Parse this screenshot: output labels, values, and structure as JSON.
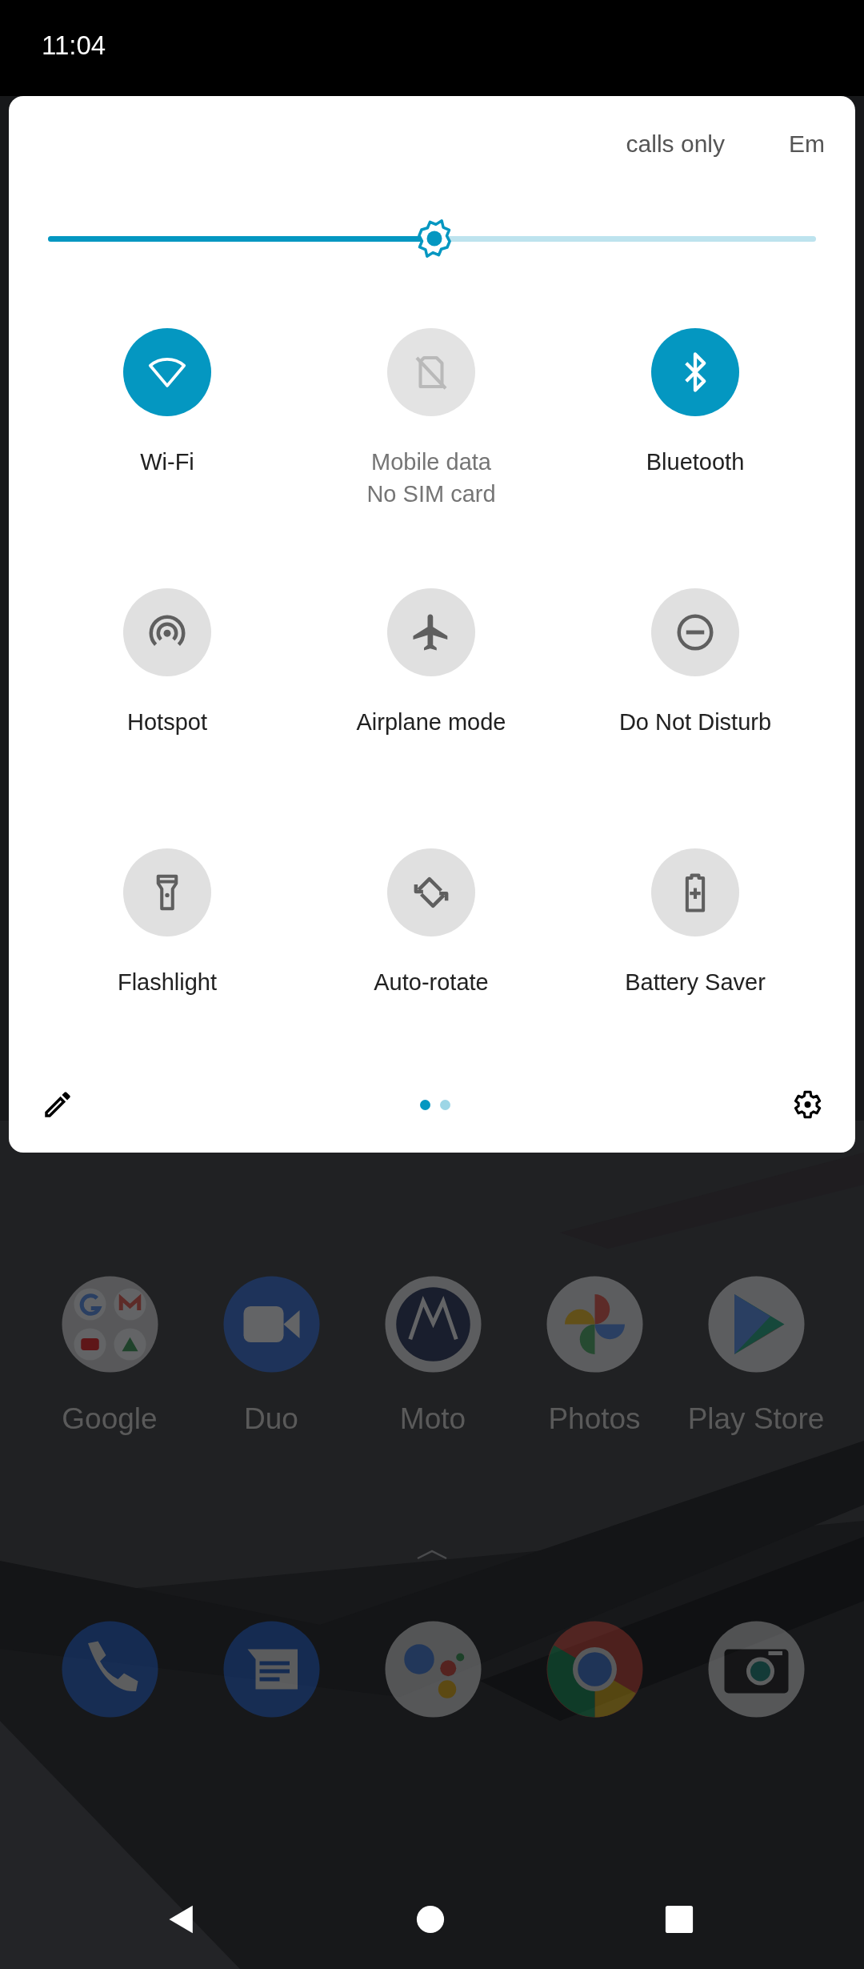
{
  "status_bar": {
    "time": "11:04"
  },
  "quick_settings": {
    "header_texts": [
      "calls only",
      "Em"
    ],
    "brightness": {
      "level": 0.503
    },
    "tiles": [
      {
        "kind": "wifi",
        "label": "Wi-Fi",
        "on": true,
        "disabled": false
      },
      {
        "kind": "mobile-data",
        "label": "Mobile data",
        "sublabel": "No SIM card",
        "on": false,
        "disabled": true
      },
      {
        "kind": "bluetooth",
        "label": "Bluetooth",
        "on": true,
        "disabled": false
      },
      {
        "kind": "hotspot",
        "label": "Hotspot",
        "on": false,
        "disabled": false
      },
      {
        "kind": "airplane",
        "label": "Airplane mode",
        "on": false,
        "disabled": false
      },
      {
        "kind": "dnd",
        "label": "Do Not Disturb",
        "on": false,
        "disabled": false
      },
      {
        "kind": "flashlight",
        "label": "Flashlight",
        "on": false,
        "disabled": false
      },
      {
        "kind": "rotate",
        "label": "Auto-rotate",
        "on": false,
        "disabled": false
      },
      {
        "kind": "battery",
        "label": "Battery Saver",
        "on": false,
        "disabled": false
      }
    ],
    "page_dots": [
      {
        "selected": true
      },
      {
        "selected": false
      }
    ]
  },
  "home_screen": {
    "apps": [
      {
        "kind": "folder",
        "label": "Google"
      },
      {
        "kind": "video",
        "label": "Duo"
      },
      {
        "kind": "moto",
        "label": "Moto"
      },
      {
        "kind": "photos",
        "label": "Photos"
      },
      {
        "kind": "play",
        "label": "Play Store"
      }
    ],
    "dock": [
      {
        "kind": "phone"
      },
      {
        "kind": "messages"
      },
      {
        "kind": "assistant"
      },
      {
        "kind": "browser"
      },
      {
        "kind": "camera"
      }
    ]
  }
}
